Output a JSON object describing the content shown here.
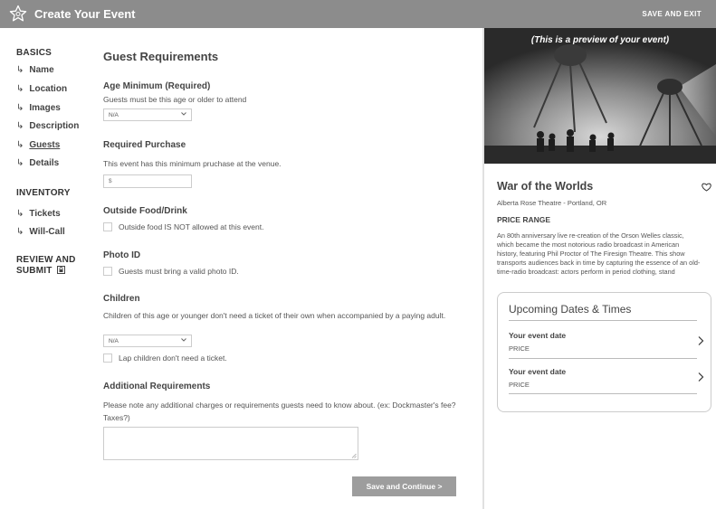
{
  "header": {
    "title": "Create Your Event",
    "save_exit": "SAVE AND EXIT"
  },
  "sidebar": {
    "basics_label": "BASICS",
    "basics_items": [
      "Name",
      "Location",
      "Images",
      "Description",
      "Guests",
      "Details"
    ],
    "active_item": "Guests",
    "inventory_label": "INVENTORY",
    "inventory_items": [
      "Tickets",
      "Will-Call"
    ],
    "review_label_line1": "REVIEW AND",
    "review_label_line2": "SUBMIT",
    "arrow_glyph": "↳"
  },
  "form": {
    "heading": "Guest Requirements",
    "age_title": "Age Minimum (Required)",
    "age_help": "Guests must be this age or older to attend",
    "age_select_value": "N/A",
    "purchase_title": "Required Purchase",
    "purchase_help": "This event has this minimum pruchase at the venue.",
    "purchase_input_prefix": "$",
    "food_title": "Outside Food/Drink",
    "food_checkbox": "Outside food IS NOT allowed at this event.",
    "photo_title": "Photo ID",
    "photo_checkbox": "Guests must bring a valid photo ID.",
    "children_title": "Children",
    "children_help": "Children of this age or younger don't need a ticket of their own when accompanied by a paying adult.",
    "children_select_value": "N/A",
    "lap_checkbox": "Lap children don't need a ticket.",
    "additional_title": "Additional Requirements",
    "additional_help": "Please note any additional charges or requirements guests need to know about. (ex: Dockmaster's fee? Taxes?)",
    "save_button": "Save and Continue >"
  },
  "preview": {
    "caption": "(This is a preview of your event)",
    "event_title": "War of the Worlds",
    "venue": "Alberta Rose Theatre - Portland, OR",
    "price_range": "PRICE RANGE",
    "description": "An 80th anniversary live re-creation of the Orson Welles classic, which became the most notorious radio broadcast in American history, featuring Phil Proctor of The Firesign Theatre. This show transports audiences back in time by capturing the essence of an old-time-radio broadcast: actors perform in period clothing, stand",
    "dates_title": "Upcoming Dates & Times",
    "dates": [
      {
        "label": "Your event date",
        "price": "PRICE"
      },
      {
        "label": "Your event date",
        "price": "PRICE"
      }
    ]
  },
  "colors": {
    "header_bg": "#8c8c8c",
    "button_bg": "#9d9d9d",
    "text": "#444444"
  },
  "icons": {
    "logo": "star-outline-icon",
    "lock": "lock-icon",
    "heart": "heart-icon",
    "chevron_right": "chevron-right-icon",
    "chevron_down": "chevron-down-icon"
  }
}
